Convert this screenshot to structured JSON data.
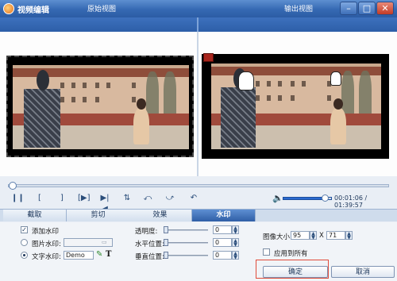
{
  "window": {
    "title": "视频编辑"
  },
  "views": {
    "original_label": "原始视图",
    "output_label": "输出视图"
  },
  "player": {
    "time_current": "00:01:06",
    "time_total": "01:39:57",
    "time_display": "00:01:06 / 01:39:57",
    "position_fraction": 0.011,
    "volume_fraction": 0.85
  },
  "controls": [
    {
      "name": "pause-button",
      "glyph": "❙❙"
    },
    {
      "name": "mark-in-button",
      "glyph": "["
    },
    {
      "name": "mark-out-button",
      "glyph": "]"
    },
    {
      "name": "play-segment-button",
      "glyph": "[▶]"
    },
    {
      "name": "jump-button",
      "glyph": "▶|◀"
    },
    {
      "name": "flip-vertical-button",
      "glyph": "⇅"
    },
    {
      "name": "rotate-left-button",
      "glyph": "⤺"
    },
    {
      "name": "rotate-right-button",
      "glyph": "⤻"
    },
    {
      "name": "undo-button",
      "glyph": "↶"
    }
  ],
  "tabs": [
    "截取",
    "剪切",
    "效果",
    "水印"
  ],
  "active_tab": "水印",
  "watermark": {
    "add_label": "添加水印",
    "add_checked": true,
    "image_label": "图片水印:",
    "text_label": "文字水印:",
    "text_value": "Demo",
    "mode": "text",
    "transparency_label": "透明度:",
    "transparency_value": "0",
    "horizontal_label": "水平位置:",
    "horizontal_value": "0",
    "vertical_label": "垂直位置:",
    "vertical_value": "0",
    "size_label": "图像大小:",
    "width_value": "95",
    "x_label": "X",
    "height_value": "71",
    "apply_all_label": "应用到所有",
    "apply_all_checked": false
  },
  "buttons": {
    "ok": "确定",
    "cancel": "取消"
  },
  "colors": {
    "titlebar": "#3569b3",
    "active_tab": "#2f5ea6",
    "marker": "#a8251d",
    "annotation": "#e04b3a"
  }
}
